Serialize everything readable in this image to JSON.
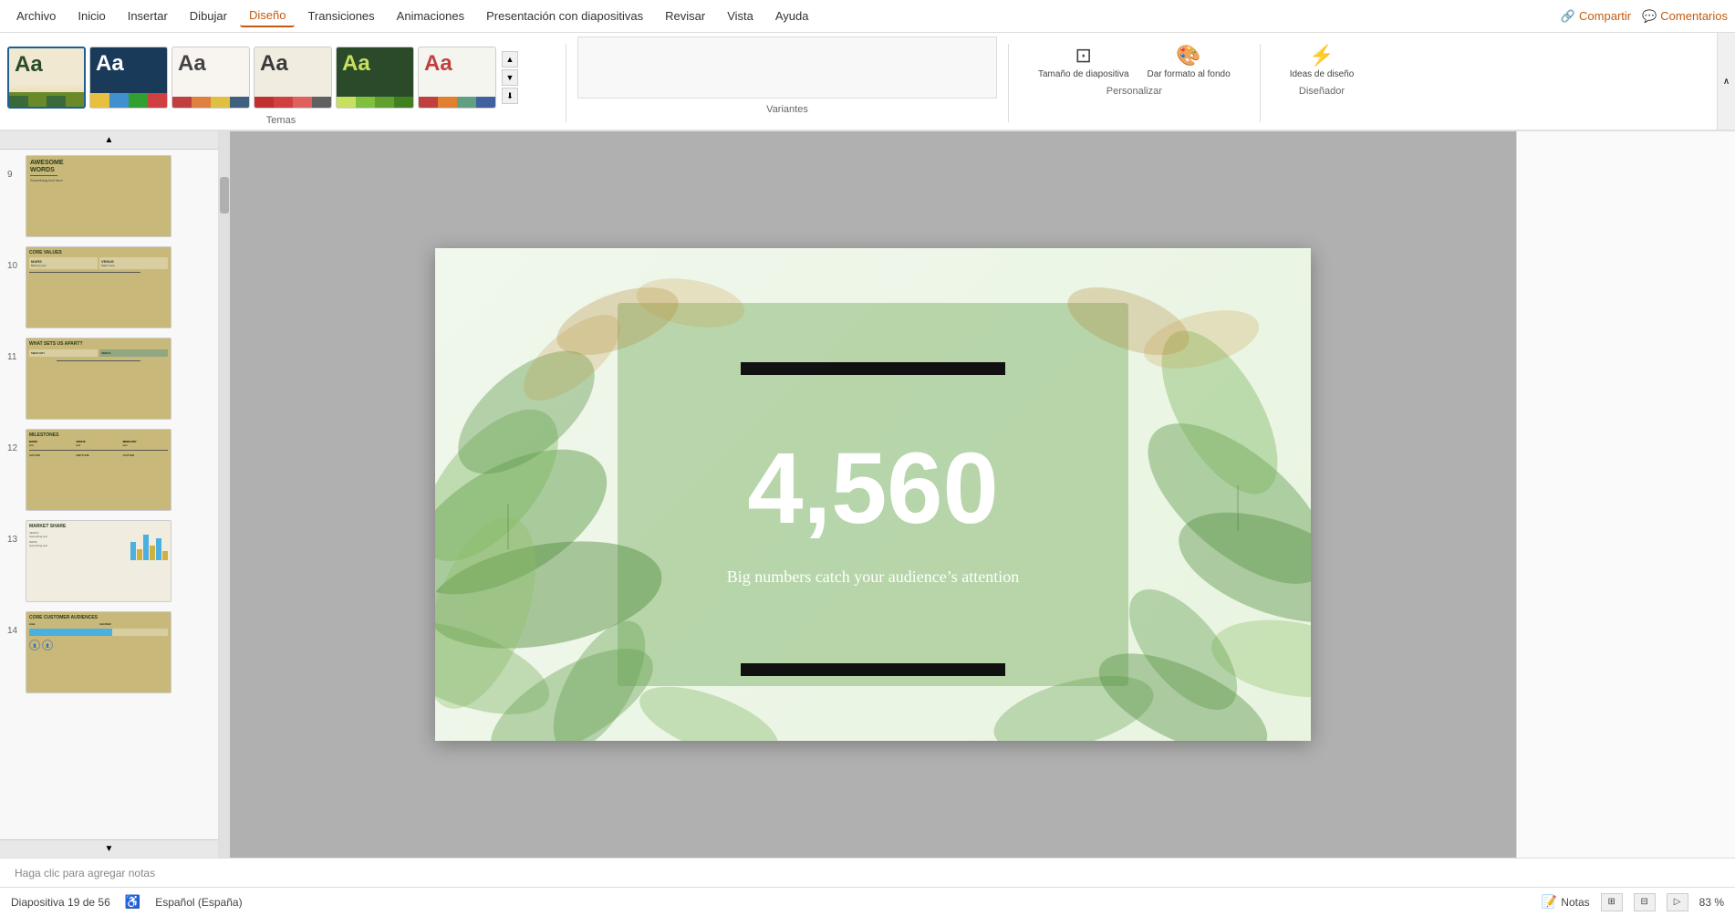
{
  "menu": {
    "items": [
      "Archivo",
      "Inicio",
      "Insertar",
      "Dibujar",
      "Diseño",
      "Transiciones",
      "Animaciones",
      "Presentación con diapositivas",
      "Revisar",
      "Vista",
      "Ayuda"
    ],
    "active_index": 4,
    "share_label": "Compartir",
    "comments_label": "Comentarios"
  },
  "ribbon": {
    "temas_label": "Temas",
    "variantes_label": "Variantes",
    "personalizar_label": "Personalizar",
    "disenador_label": "Diseñador",
    "tamano_btn": "Tamaño de diapositiva",
    "formato_btn": "Dar formato al fondo",
    "ideas_btn": "Ideas de diseño",
    "themes": [
      {
        "label": "Aa",
        "style": "theme0"
      },
      {
        "label": "Aa",
        "style": "theme1"
      },
      {
        "label": "Aa",
        "style": "theme2"
      },
      {
        "label": "Aa",
        "style": "theme3"
      },
      {
        "label": "Aa",
        "style": "theme4"
      },
      {
        "label": "Aa",
        "style": "theme5"
      }
    ]
  },
  "slides": [
    {
      "number": "9",
      "title": "AWESOME WORDS",
      "type": "awesome-words"
    },
    {
      "number": "10",
      "title": "CORE VALUES",
      "type": "core-values",
      "content": "MARS MERCURY\nVENUS\nSATURN"
    },
    {
      "number": "11",
      "title": "WHAT SETS US APART?",
      "type": "what-sets-apart",
      "content": "MERCURY VENUS"
    },
    {
      "number": "12",
      "title": "MILESTONES",
      "type": "milestones",
      "content": "MARS VENUS MERCURY\nSATURN NEPTUNE JUPITER"
    },
    {
      "number": "13",
      "title": "MARKET SHARE",
      "type": "market-share",
      "content": "VENUS\nMARS"
    },
    {
      "number": "14",
      "title": "CORE CUSTOMER AUDIENCES",
      "type": "core-customer",
      "content": "AGE GENDER"
    }
  ],
  "main_slide": {
    "number": "4,560",
    "subtitle": "Big numbers catch your audience’s attention",
    "bar_top": "",
    "bar_bottom": ""
  },
  "status": {
    "slide_info": "Diapositiva 19 de 56",
    "language": "Español (España)",
    "notes_label": "Notas",
    "zoom": "83 %",
    "notes_placeholder": "Haga clic para agregar notas"
  }
}
